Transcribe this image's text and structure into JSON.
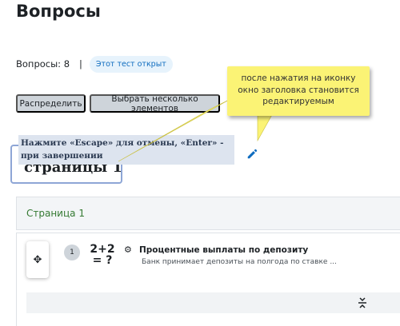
{
  "page": {
    "title": "Вопросы"
  },
  "summary": {
    "questions_label": "Вопросы: 8",
    "separator": "|",
    "quiz_open_badge": "Этот тест открыт"
  },
  "toolbar": {
    "distribute_label": "Распределить",
    "select_multiple_label": "Выбрать несколько элементов"
  },
  "title_editor": {
    "value": "страницы 1",
    "hint": "Нажмите «Escape» для отмены, «Enter» - при завершении"
  },
  "icons": {
    "edit": "pencil-icon",
    "move": "move-icon",
    "settings": "gear-icon",
    "collapse": "collapse-icon"
  },
  "section": {
    "label": "Страница 1"
  },
  "question": {
    "number": "1",
    "type_icon_text": "2+2\n= ?",
    "name": "Процентные выплаты по депозиту",
    "text": "Банк принимает депозиты на полгода по ставке ..."
  },
  "annotation": {
    "text": "после нажатия на иконку окно заголовка становится редактируемым",
    "color": "#fbf375"
  },
  "colors": {
    "accent": "#0f6cbf",
    "section_label": "#357a32",
    "badge_bg": "#e7f3fc"
  }
}
